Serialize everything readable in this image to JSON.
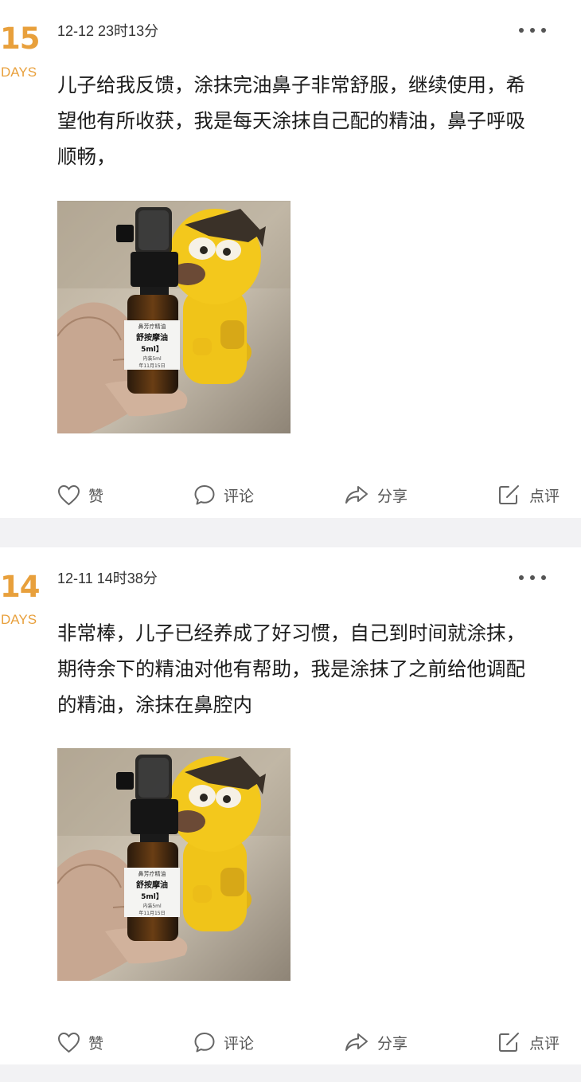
{
  "posts": [
    {
      "day_number": "15",
      "day_unit": "DAYS",
      "timestamp": "12-12 23时13分",
      "text": "儿子给我反馈，涂抹完油鼻子非常舒服，继续使用，希望他有所收获，我是每天涂抹自己配的精油，鼻子呼吸顺畅，",
      "photo": {
        "label_line1": "鼻芳疗精油",
        "label_line2": "舒按摩油",
        "label_line3": "5ml】",
        "label_line4": "内装5ml",
        "label_line5": "年11月15日"
      },
      "actions": {
        "like": "赞",
        "comment": "评论",
        "share": "分享",
        "review": "点评"
      }
    },
    {
      "day_number": "14",
      "day_unit": "DAYS",
      "timestamp": "12-11 14时38分",
      "text": "非常棒，儿子已经养成了好习惯，自己到时间就涂抹，期待余下的精油对他有帮助，我是涂抹了之前给他调配的精油，涂抹在鼻腔内",
      "photo": {
        "label_line1": "鼻芳疗精油",
        "label_line2": "舒按摩油",
        "label_line3": "5ml】",
        "label_line4": "内装5ml",
        "label_line5": "年11月15日"
      },
      "actions": {
        "like": "赞",
        "comment": "评论",
        "share": "分享",
        "review": "点评"
      }
    }
  ],
  "colors": {
    "accent": "#e8a03c",
    "separator": "#f2f2f4",
    "text": "#1c1c1c",
    "muted": "#555555"
  },
  "icons": {
    "like": "heart-icon",
    "comment": "comment-bubble-icon",
    "share": "share-arrow-icon",
    "review": "edit-note-icon",
    "more": "more-dots-icon"
  }
}
